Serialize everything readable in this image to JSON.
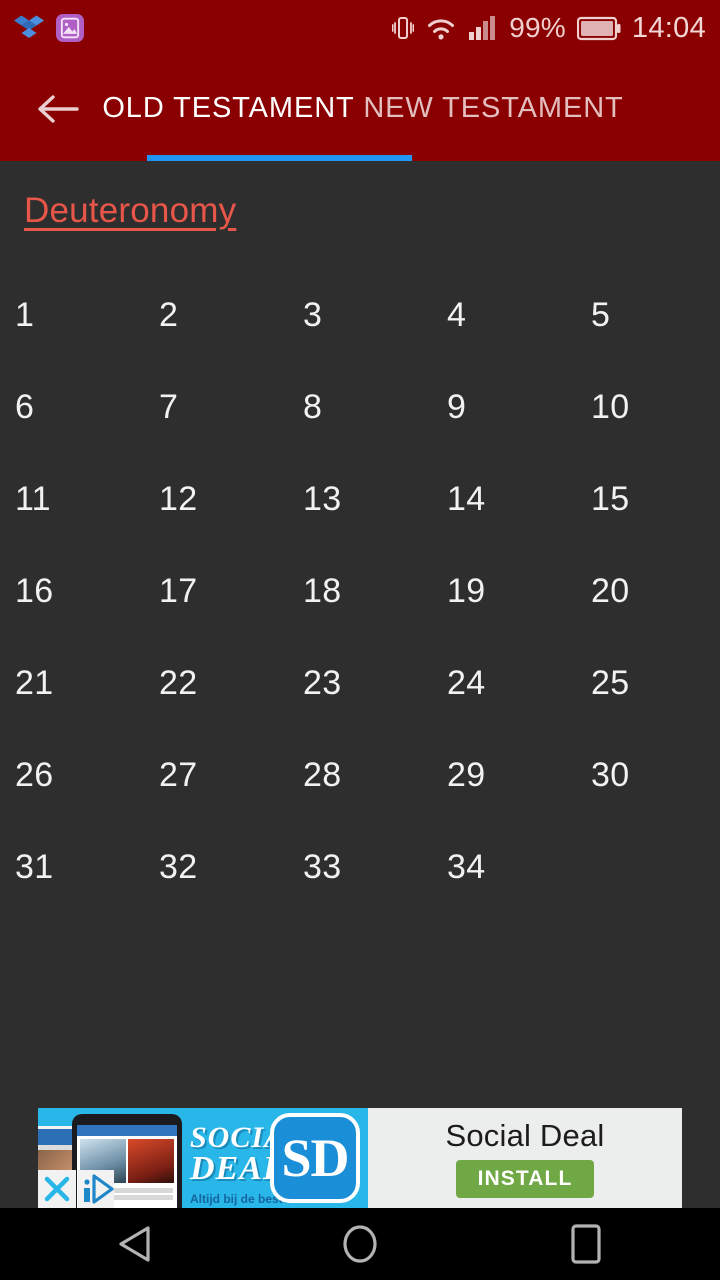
{
  "status_bar": {
    "notification_icons": [
      "dropbox-icon",
      "gallery-icon"
    ],
    "vibrate_icon": "vibrate-icon",
    "wifi_icon": "wifi-icon",
    "signal_icon": "signal-icon",
    "battery_percent": "99%",
    "battery_icon": "battery-icon",
    "clock": "14:04",
    "background_color": "#8a0000",
    "text_color": "#f0cfcf"
  },
  "app_bar": {
    "back_icon": "arrow-left-icon",
    "tabs": [
      {
        "label": "OLD TESTAMENT",
        "active": true
      },
      {
        "label": "NEW TESTAMENT",
        "active": false
      }
    ],
    "indicator_color": "#2196f3",
    "background_color": "#8a0000",
    "active_tab_color": "#ffffff",
    "inactive_tab_color": "#e3bebe"
  },
  "content": {
    "book_title": "Deuteronomy",
    "title_color": "#e8564a",
    "background_color": "#2e2e2e",
    "chapter_text_color": "#f2f2f2",
    "columns": 5,
    "chapters": [
      "1",
      "2",
      "3",
      "4",
      "5",
      "6",
      "7",
      "8",
      "9",
      "10",
      "11",
      "12",
      "13",
      "14",
      "15",
      "16",
      "17",
      "18",
      "19",
      "20",
      "21",
      "22",
      "23",
      "24",
      "25",
      "26",
      "27",
      "28",
      "29",
      "30",
      "31",
      "32",
      "33",
      "34"
    ]
  },
  "ad": {
    "brand_line1": "SOCIAL",
    "brand_line2": "DEAL",
    "brand_subtitle": "Altijd bij de beste",
    "logo_text": "SD",
    "title": "Social Deal",
    "install_label": "INSTALL",
    "close_icon": "close-x-icon",
    "adchoices_icon": "adchoices-icon",
    "left_background": "#29b6e8",
    "right_background": "#eceded",
    "install_color": "#6fa844",
    "logo_color": "#1a8fd8"
  },
  "nav_bar": {
    "background_color": "#000000",
    "buttons": [
      {
        "name": "back-nav-button",
        "icon": "triangle-back-icon"
      },
      {
        "name": "home-nav-button",
        "icon": "circle-home-icon"
      },
      {
        "name": "recents-nav-button",
        "icon": "square-recents-icon"
      }
    ]
  }
}
